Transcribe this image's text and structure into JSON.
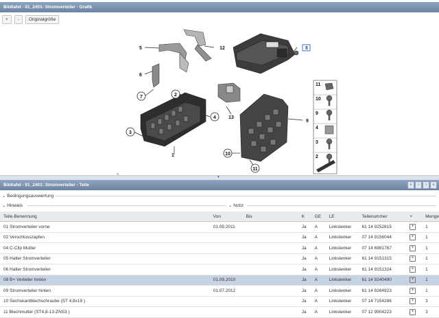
{
  "graphic_panel": {
    "title": "Bildtafel - 01_2401: Stromverteiler - Grafik",
    "toolbar": {
      "zoom_in": "+",
      "zoom_out": "-",
      "original_size": "Originalgröße"
    }
  },
  "diagram": {
    "callouts": [
      "1",
      "2",
      "3",
      "4",
      "5",
      "6",
      "7",
      "8",
      "9",
      "10",
      "11",
      "12",
      "13"
    ],
    "legend_numbers": [
      "11",
      "10",
      "9",
      "4",
      "3",
      "2"
    ],
    "footer_code": "S"
  },
  "parts_panel": {
    "title": "Bildtafel - 01_2401: Stromverteiler - Teile",
    "nav": [
      "«",
      "‹",
      "›",
      "»"
    ],
    "condition_label": "Bedingungsauswertung",
    "hint_label": "Hinweis",
    "note_label": "Notiz",
    "columns": [
      "Teile-Benennung",
      "Von",
      "Bis",
      "K",
      "GE",
      "LE",
      "Teilenummer",
      "+",
      "Menge"
    ],
    "rows": [
      {
        "name": "01 Stromverteiler vorne",
        "von": "01.09.2011",
        "bis": "",
        "k": "Ja",
        "ge": "A",
        "le": "Linkslenker",
        "nr": "61 14 9252815",
        "menge": "1"
      },
      {
        "name": "02 Verschlusszapfen",
        "von": "",
        "bis": "",
        "k": "Ja",
        "ge": "A",
        "le": "Linkslenker",
        "nr": "07 14 9156044",
        "menge": "1"
      },
      {
        "name": "04 C-Clip Mutter",
        "von": "",
        "bis": "",
        "k": "Ja",
        "ge": "A",
        "le": "Linkslenker",
        "nr": "07 14 6981767",
        "menge": "1"
      },
      {
        "name": "05 Halter Stromverteiler",
        "von": "",
        "bis": "",
        "k": "Ja",
        "ge": "A",
        "le": "Linkslenker",
        "nr": "61 14 9151315",
        "menge": "1"
      },
      {
        "name": "06 Halter Stromverteiler",
        "von": "",
        "bis": "",
        "k": "Ja",
        "ge": "A",
        "le": "Linkslenker",
        "nr": "61 14 9151324",
        "menge": "1"
      },
      {
        "name": "08 B+ Verteiler hinten",
        "von": "01.09.2010",
        "bis": "",
        "k": "Ja",
        "ge": "A",
        "le": "Linkslenker",
        "nr": "61 14 9240490",
        "menge": "1"
      },
      {
        "name": "09 Stromverteiler hinten",
        "von": "01.07.2012",
        "bis": "",
        "k": "Ja",
        "ge": "A",
        "le": "Linkslenker",
        "nr": "61 14 9264923",
        "menge": "1"
      },
      {
        "name": "10 Sechskantblechschraube (ST 4,8x19 )",
        "von": "",
        "bis": "",
        "k": "Ja",
        "ge": "A",
        "le": "Linkslenker",
        "nr": "07 14 7154286",
        "menge": "3"
      },
      {
        "name": "11 Blechmutter (ST4,8-13-ZNS3 )",
        "von": "",
        "bis": "",
        "k": "Ja",
        "ge": "A",
        "le": "Linkslenker",
        "nr": "07 12 9904223",
        "menge": "3"
      }
    ],
    "selected_row": 5
  }
}
